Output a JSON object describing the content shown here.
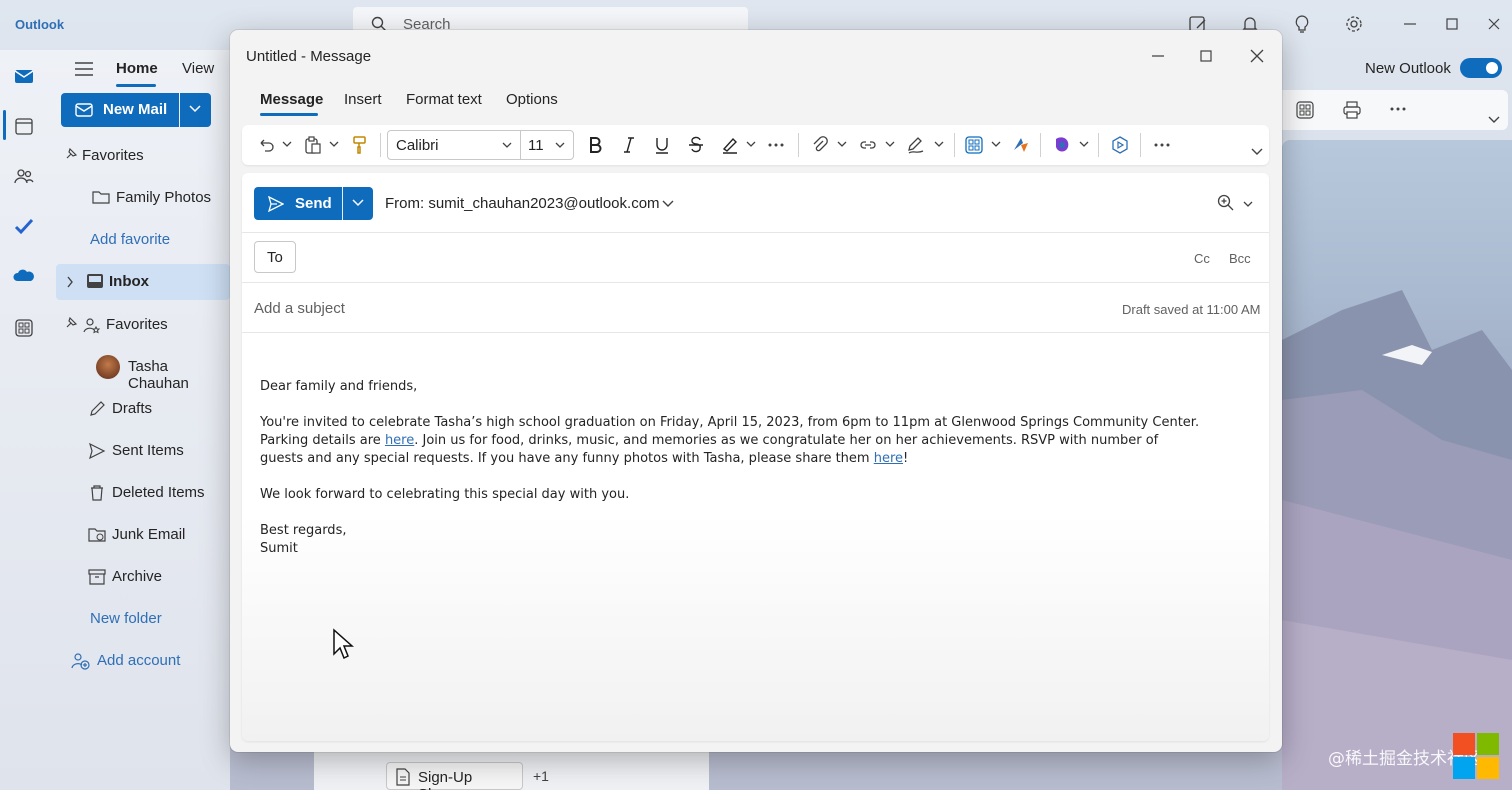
{
  "app": {
    "title": "Outlook",
    "search_placeholder": "Search"
  },
  "ribbon_main": {
    "tabs": [
      "Home",
      "View"
    ],
    "new_mail_label": "New Mail"
  },
  "folders": {
    "favorites_header": "Favorites",
    "family_photos": "Family Photos",
    "add_favorite": "Add favorite",
    "inbox": "Inbox",
    "favorites2": "Favorites",
    "contact": "Tasha Chauhan",
    "drafts": "Drafts",
    "sent": "Sent Items",
    "deleted": "Deleted Items",
    "junk": "Junk Email",
    "archive": "Archive",
    "new_folder": "New folder",
    "add_account": "Add account"
  },
  "right_header": {
    "new_outlook_label": "New Outlook",
    "new_outlook_enabled": true
  },
  "compose": {
    "window_title": "Untitled - Message",
    "tabs": [
      "Message",
      "Insert",
      "Format text",
      "Options"
    ],
    "font_name": "Calibri",
    "font_size": "11",
    "send_label": "Send",
    "from": "From: sumit_chauhan2023@outlook.com",
    "to_label": "To",
    "cc_label": "Cc",
    "bcc_label": "Bcc",
    "subject_placeholder": "Add a subject",
    "draft_status": "Draft saved at 11:00 AM",
    "body": {
      "greeting": "Dear family and friends,",
      "p1_a": "You're invited to celebrate Tasha’s high school graduation on Friday, April 15, 2023, from 6pm to 11pm at Glenwood Springs Community Center. Parking details are ",
      "p1_link1": "here",
      "p1_b": ". Join us for food, drinks, music, and memories as we congratulate her on her achievements. RSVP with number of guests and any special requests. If you have any funny photos with Tasha, please share them ",
      "p1_link2": "here",
      "p1_c": "!",
      "p2": "We look forward to celebrating this special day with you.",
      "closing": "Best regards,",
      "signature": "Sumit"
    }
  },
  "attachments": {
    "chip_label": "Sign-Up Shee...",
    "more": "+1"
  },
  "watermark": "@稀土掘金技术社区",
  "colors": {
    "accent": "#0f6cbd",
    "link": "#2f6fb6"
  }
}
